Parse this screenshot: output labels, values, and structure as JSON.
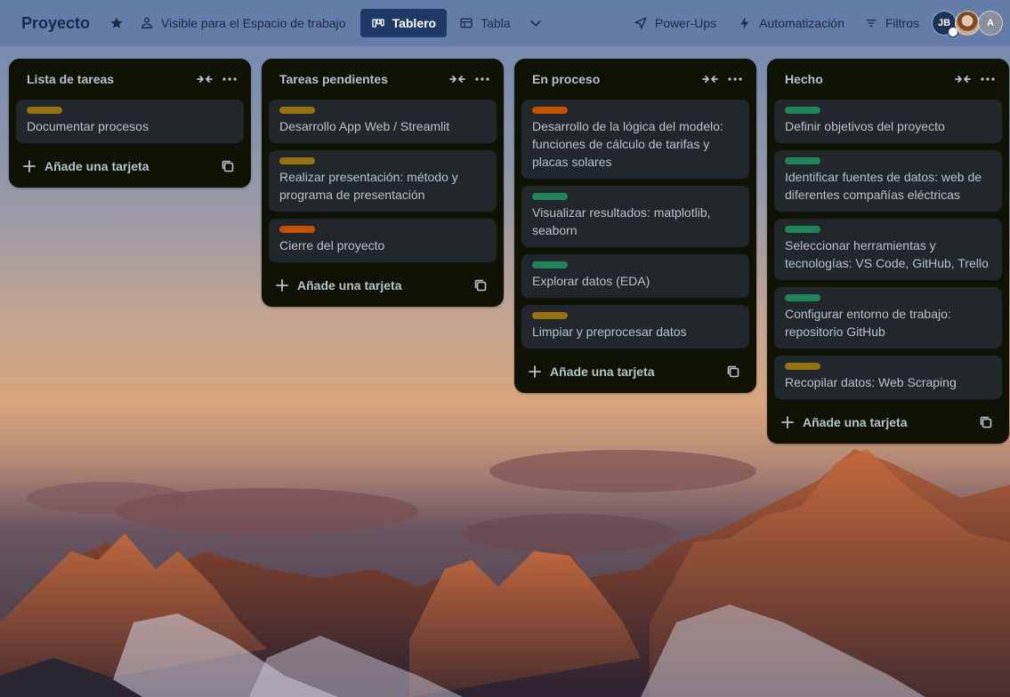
{
  "board": {
    "title": "Proyecto",
    "visibility_label": "Visible para el Espacio de trabajo",
    "views": [
      {
        "label": "Tablero",
        "active": true
      },
      {
        "label": "Tabla",
        "active": false
      }
    ],
    "actions": {
      "powerups": "Power-Ups",
      "automation": "Automatización",
      "filters": "Filtros"
    },
    "members": [
      {
        "initials": "JB",
        "icon": "avatar-initials"
      },
      {
        "initials": "",
        "icon": "avatar-photo"
      },
      {
        "initials": "A",
        "icon": "avatar-initials"
      }
    ]
  },
  "colors": {
    "label_yellow": "#947214",
    "label_orange": "#c25100",
    "label_green": "#1f845a",
    "list_bg": "#101204",
    "card_bg": "#22272b",
    "active_tab": "#1f3a66"
  },
  "add_card_label": "Añade una tarjeta",
  "lists": [
    {
      "title": "Lista de tareas",
      "cards": [
        {
          "text": "Documentar procesos",
          "label": "yellow"
        }
      ]
    },
    {
      "title": "Tareas pendientes",
      "cards": [
        {
          "text": "Desarrollo App Web / Streamlit",
          "label": "yellow"
        },
        {
          "text": "Realizar presentación: método y programa de presentación",
          "label": "yellow"
        },
        {
          "text": "Cierre del proyecto",
          "label": "orange"
        }
      ]
    },
    {
      "title": "En proceso",
      "cards": [
        {
          "text": "Desarrollo de la lógica del modelo: funciones de cálculo de tarifas y placas solares",
          "label": "orange"
        },
        {
          "text": "Visualizar resultados: matplotlib, seaborn",
          "label": "green"
        },
        {
          "text": "Explorar datos (EDA)",
          "label": "green"
        },
        {
          "text": "Limpiar y preprocesar datos",
          "label": "yellow"
        }
      ]
    },
    {
      "title": "Hecho",
      "cards": [
        {
          "text": "Definir objetivos del proyecto",
          "label": "green"
        },
        {
          "text": "Identificar fuentes de datos: web de diferentes compañías eléctricas",
          "label": "green"
        },
        {
          "text": "Seleccionar herramientas y tecnologías: VS Code, GitHub, Trello",
          "label": "green"
        },
        {
          "text": "Configurar entorno de trabajo: repositorio GitHub",
          "label": "green"
        },
        {
          "text": "Recopilar datos: Web Scraping",
          "label": "yellow"
        }
      ]
    }
  ]
}
